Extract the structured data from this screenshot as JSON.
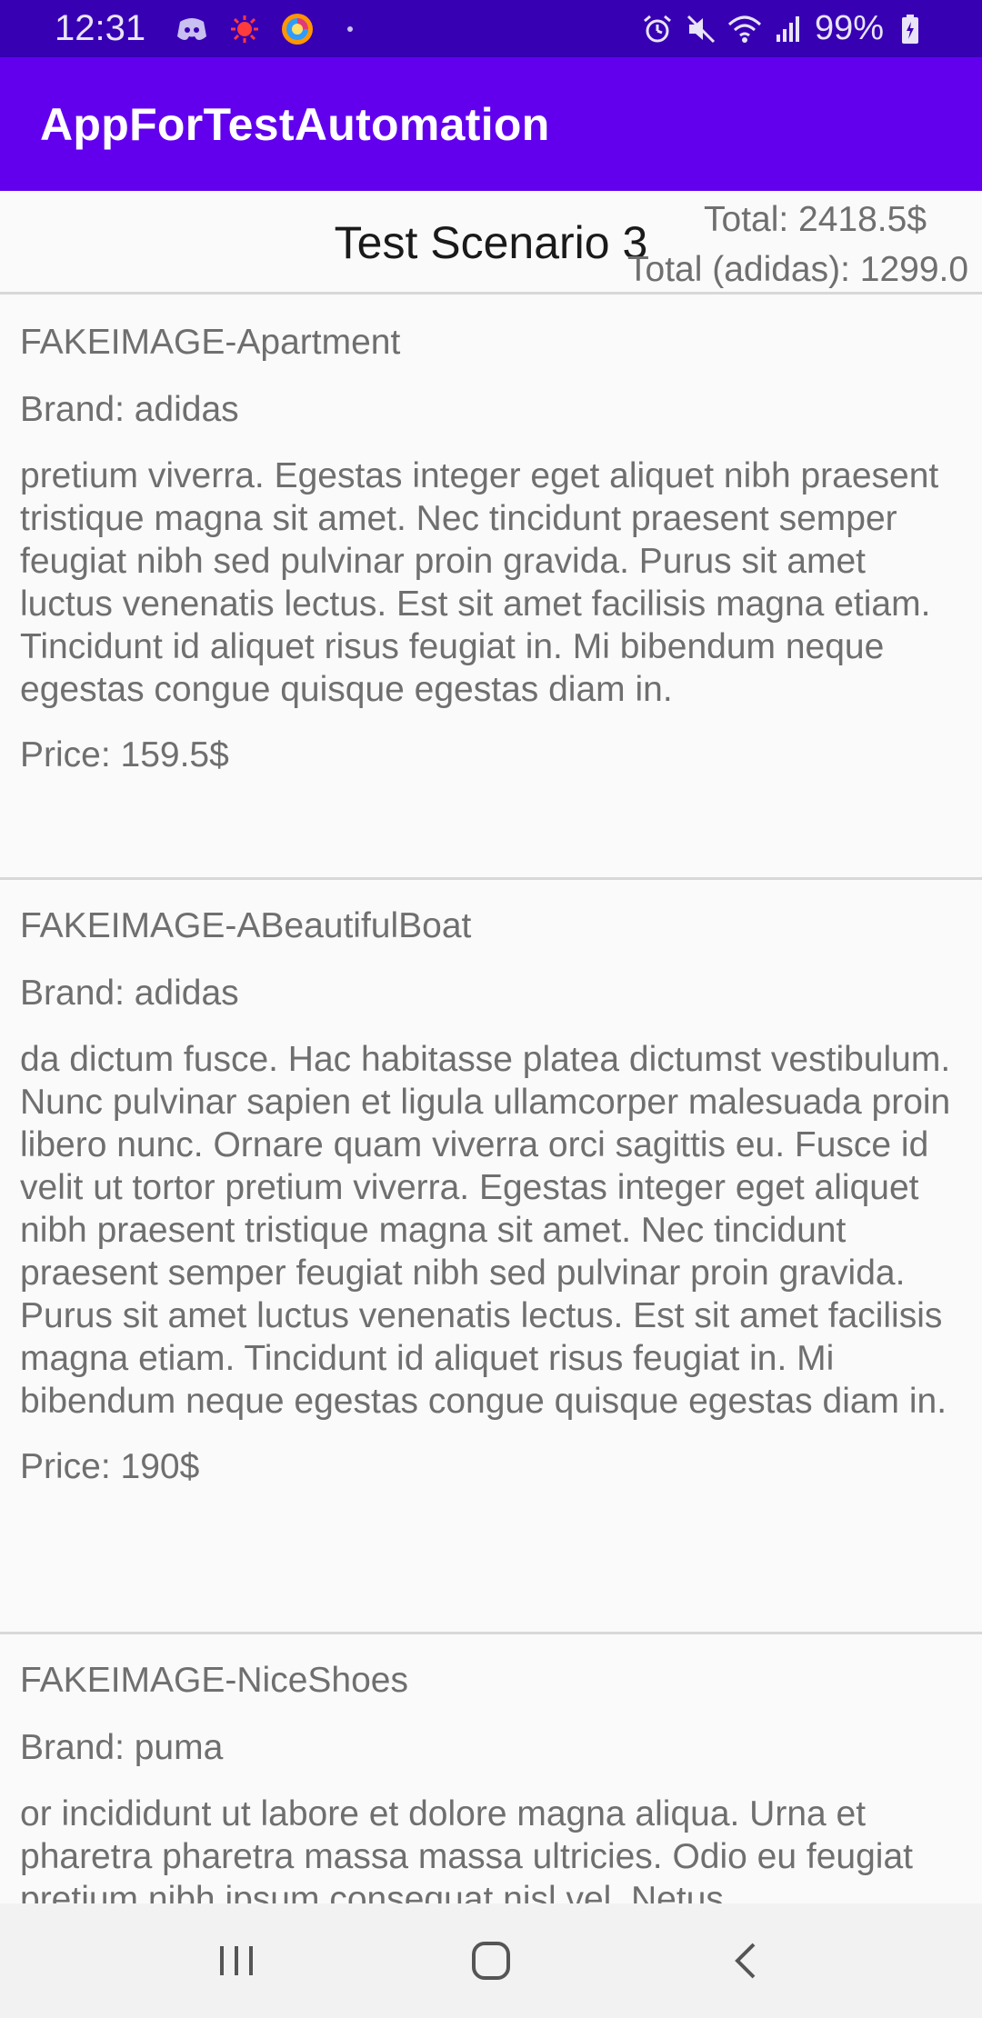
{
  "status_bar": {
    "time": "12:31",
    "battery": "99%",
    "left_icons": [
      "discord-icon",
      "badge-icon",
      "firefox-icon",
      "dot-icon"
    ],
    "right_icons": [
      "alarm-icon",
      "mute-icon",
      "wifi-icon",
      "signal-icon",
      "battery-icon"
    ]
  },
  "app_bar": {
    "title": "AppForTestAutomation",
    "color": "#6200ee"
  },
  "header": {
    "title": "Test Scenario 3",
    "total": "Total: 2418.5$",
    "total_brand": "Total (adidas): 1299.0"
  },
  "products": [
    {
      "name": "FAKEIMAGE-Apartment",
      "brand": "Brand: adidas",
      "description": " pretium viverra. Egestas integer eget aliquet nibh praesent tristique magna sit amet. Nec tincidunt praesent semper feugiat nibh sed pulvinar proin gravida. Purus sit amet luctus venenatis lectus. Est sit amet facilisis magna etiam. Tincidunt id aliquet risus feugiat in. Mi bibendum neque egestas congue quisque egestas diam in.",
      "price": "Price: 159.5$"
    },
    {
      "name": "FAKEIMAGE-ABeautifulBoat",
      "brand": "Brand: adidas",
      "description": "da dictum fusce. Hac habitasse platea dictumst vestibulum. Nunc pulvinar sapien et ligula ullamcorper malesuada proin libero nunc. Ornare quam viverra orci sagittis eu. Fusce id velit ut tortor pretium viverra. Egestas integer eget aliquet nibh praesent tristique magna sit amet. Nec tincidunt praesent semper feugiat nibh sed pulvinar proin gravida. Purus sit amet luctus venenatis lectus. Est sit amet facilisis magna etiam. Tincidunt id aliquet risus feugiat in. Mi bibendum neque egestas congue quisque egestas diam in.",
      "price": "Price: 190$"
    },
    {
      "name": "FAKEIMAGE-NiceShoes",
      "brand": "Brand: puma",
      "description": "or incididunt ut labore et dolore magna aliqua. Urna et pharetra pharetra massa massa ultricies. Odio eu feugiat pretium nibh ipsum consequat nisl vel. Netus",
      "price": ""
    }
  ],
  "nav_bar": {
    "buttons": [
      "recents-icon",
      "home-icon",
      "back-icon"
    ]
  }
}
